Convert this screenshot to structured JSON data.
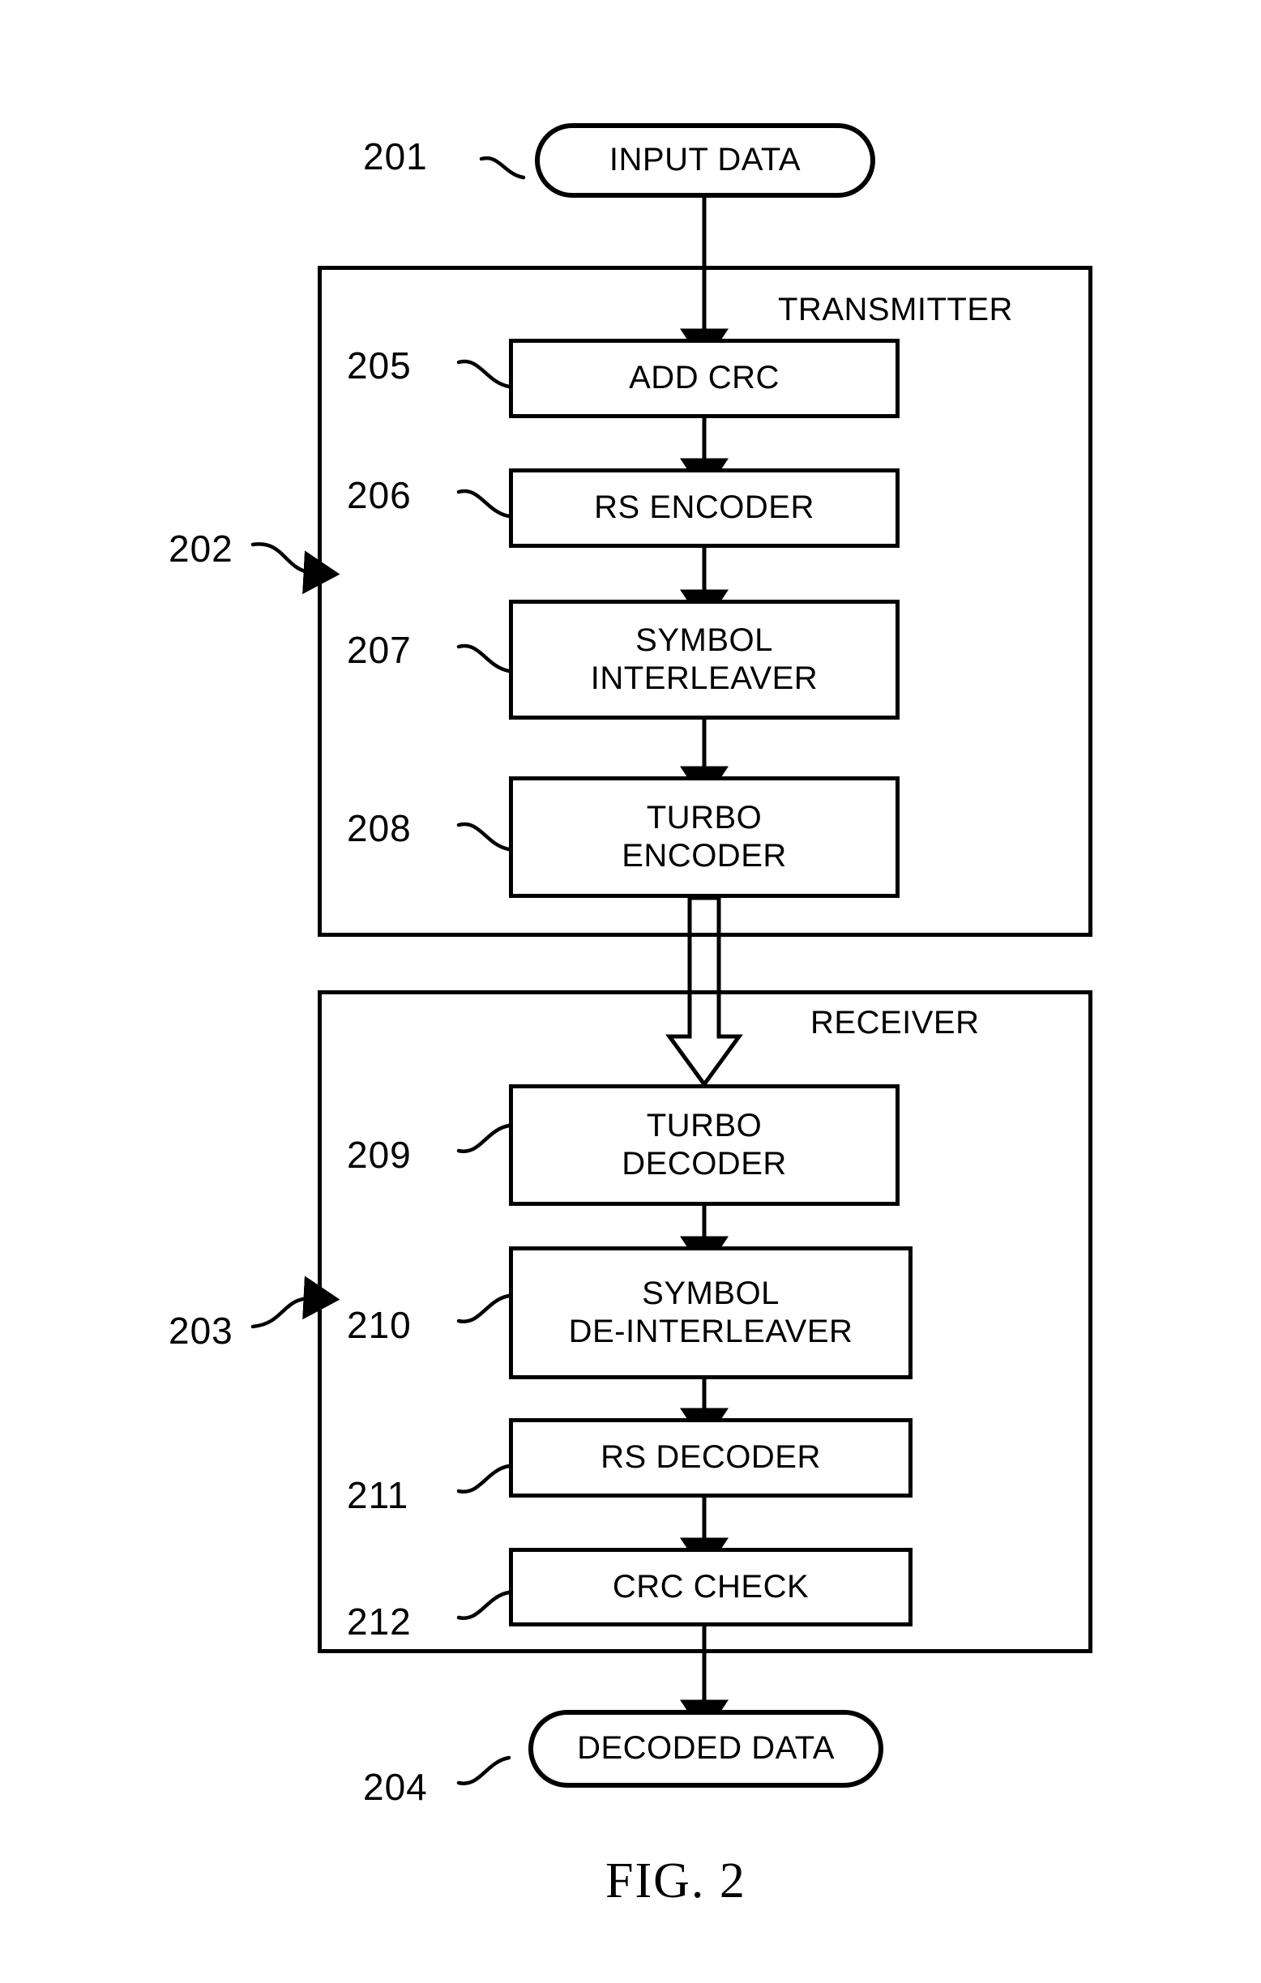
{
  "figure": {
    "caption": "FIG. 2",
    "title": "Transmitter and receiver coding chain block diagram"
  },
  "terminals": [
    {
      "ref": "201",
      "label": "INPUT DATA",
      "shape": "stadium"
    },
    {
      "ref": "204",
      "label": "DECODED DATA",
      "shape": "stadium"
    }
  ],
  "groups": [
    {
      "ref": "202",
      "label": "TRANSMITTER"
    },
    {
      "ref": "203",
      "label": "RECEIVER"
    }
  ],
  "transmitter_blocks": [
    {
      "ref": "205",
      "line1": "ADD CRC",
      "line2": ""
    },
    {
      "ref": "206",
      "line1": "RS ENCODER",
      "line2": ""
    },
    {
      "ref": "207",
      "line1": "SYMBOL",
      "line2": "INTERLEAVER"
    },
    {
      "ref": "208",
      "line1": "TURBO",
      "line2": "ENCODER"
    }
  ],
  "receiver_blocks": [
    {
      "ref": "209",
      "line1": "TURBO",
      "line2": "DECODER"
    },
    {
      "ref": "210",
      "line1": "SYMBOL",
      "line2": "DE-INTERLEAVER"
    },
    {
      "ref": "211",
      "line1": "RS DECODER",
      "line2": ""
    },
    {
      "ref": "212",
      "line1": "CRC CHECK",
      "line2": ""
    }
  ],
  "colors": {
    "ink": "#000000",
    "paper": "#ffffff"
  }
}
